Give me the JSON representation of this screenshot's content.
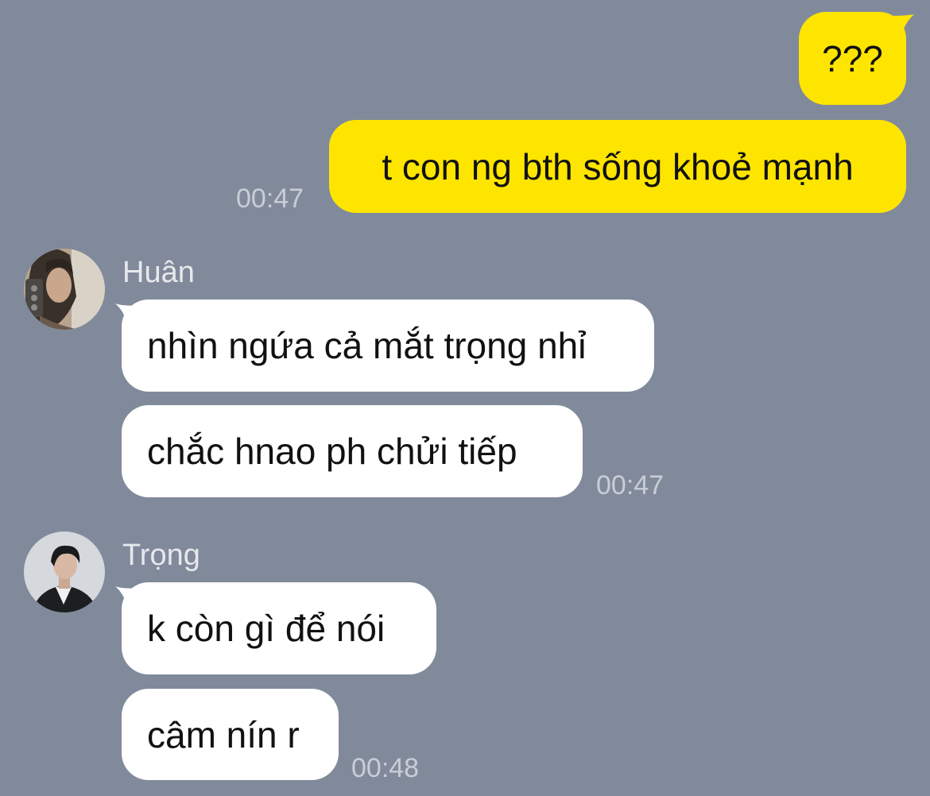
{
  "colors": {
    "background": "#818a9b",
    "outgoing_bubble": "#fee500",
    "incoming_bubble": "#ffffff",
    "timestamp": "#c9cdd5",
    "sender_name": "#e6e8ec"
  },
  "outgoing": {
    "messages": [
      "???",
      "t con ng bth sống khoẻ mạnh"
    ],
    "time": "00:47"
  },
  "groups": [
    {
      "sender": "Huân",
      "avatar_icon": "user-avatar-photo",
      "messages": [
        "nhìn ngứa cả mắt trọng nhỉ",
        "chắc hnao ph chửi tiếp"
      ],
      "time": "00:47"
    },
    {
      "sender": "Trọng",
      "avatar_icon": "user-avatar-photo",
      "messages": [
        "k còn gì để nói",
        "câm nín r"
      ],
      "time": "00:48"
    }
  ]
}
